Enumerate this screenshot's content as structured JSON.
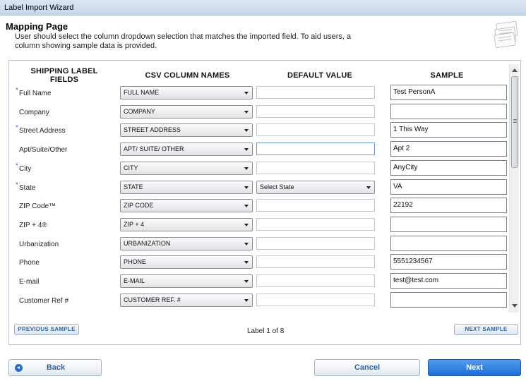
{
  "window": {
    "title": "Label Import Wizard"
  },
  "header": {
    "title": "Mapping Page",
    "description": "User should select the column dropdown selection that matches the imported field.  To aid users, a column showing sample data is provided."
  },
  "columns": {
    "fields": "SHIPPING LABEL FIELDS",
    "csv": "CSV COLUMN NAMES",
    "default": "DEFAULT VALUE",
    "sample": "SAMPLE"
  },
  "rows": [
    {
      "label": "Full Name",
      "required": true,
      "csv": "FULL NAME",
      "default_type": "text",
      "default_value": "",
      "sample": "Test PersonA"
    },
    {
      "label": "Company",
      "required": false,
      "csv": "COMPANY",
      "default_type": "text",
      "default_value": "",
      "sample": ""
    },
    {
      "label": "Street Address",
      "required": true,
      "csv": "STREET ADDRESS",
      "default_type": "text",
      "default_value": "",
      "sample": "1 This Way"
    },
    {
      "label": "Apt/Suite/Other",
      "required": false,
      "csv": "APT/ SUITE/ OTHER",
      "default_type": "text",
      "default_value": "",
      "sample": "Apt 2",
      "focused": true
    },
    {
      "label": "City",
      "required": true,
      "csv": "CITY",
      "default_type": "text",
      "default_value": "",
      "sample": "AnyCity"
    },
    {
      "label": "State",
      "required": true,
      "csv": "STATE",
      "default_type": "select",
      "default_value": "Select State",
      "sample": "VA"
    },
    {
      "label": "ZIP Code™",
      "required": false,
      "csv": "ZIP CODE",
      "default_type": "text",
      "default_value": "",
      "sample": "22192"
    },
    {
      "label": "ZIP + 4®",
      "required": false,
      "csv": "ZIP + 4",
      "default_type": "text",
      "default_value": "",
      "sample": ""
    },
    {
      "label": "Urbanization",
      "required": false,
      "csv": "URBANIZATION",
      "default_type": "text",
      "default_value": "",
      "sample": ""
    },
    {
      "label": "Phone",
      "required": false,
      "csv": "PHONE",
      "default_type": "text",
      "default_value": "",
      "sample": "5551234567"
    },
    {
      "label": "E-mail",
      "required": false,
      "csv": "E-MAIL",
      "default_type": "text",
      "default_value": "",
      "sample": "test@test.com"
    },
    {
      "label": "Customer Ref #",
      "required": false,
      "csv": "CUSTOMER REF. #",
      "default_type": "text",
      "default_value": "",
      "sample": ""
    }
  ],
  "required_marker": "*",
  "pager": {
    "previous": "PREVIOUS SAMPLE",
    "next": "NEXT SAMPLE",
    "status": "Label 1 of 8"
  },
  "footer": {
    "back": "Back",
    "cancel": "Cancel",
    "next": "Next"
  },
  "icons": {
    "header": "label-sheets-icon",
    "back": "back-arrow-icon",
    "dropdown": "chevron-down-icon"
  },
  "colors": {
    "accent": "#2c63a5",
    "primary_button": "#1f6fd4",
    "required": "#3a6fc4"
  }
}
